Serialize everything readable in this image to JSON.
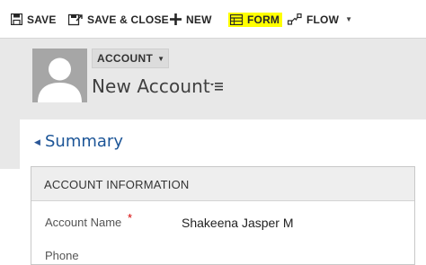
{
  "toolbar": {
    "save_label": "SAVE",
    "save_close_label": "SAVE & CLOSE",
    "new_label": "NEW",
    "form_label": "FORM",
    "flow_label": "FLOW"
  },
  "header": {
    "entity_type": "ACCOUNT",
    "record_name": "New Account"
  },
  "content": {
    "tab_title": "Summary",
    "section_title": "ACCOUNT INFORMATION",
    "fields": [
      {
        "label": "Account Name",
        "required_mark": "*",
        "value": "Shakeena Jasper M"
      },
      {
        "label": "Phone"
      }
    ]
  },
  "colors": {
    "form_highlight": "#ffff00",
    "summary_link": "#1c5597",
    "required": "#d60000",
    "header_band": "#e8e8e8"
  },
  "icons": [
    "save-icon",
    "save-close-icon",
    "plus-icon",
    "form-icon",
    "flow-icon",
    "chevron-down-icon",
    "person-silhouette-icon",
    "record-menu-icon",
    "collapse-triangle-icon"
  ]
}
